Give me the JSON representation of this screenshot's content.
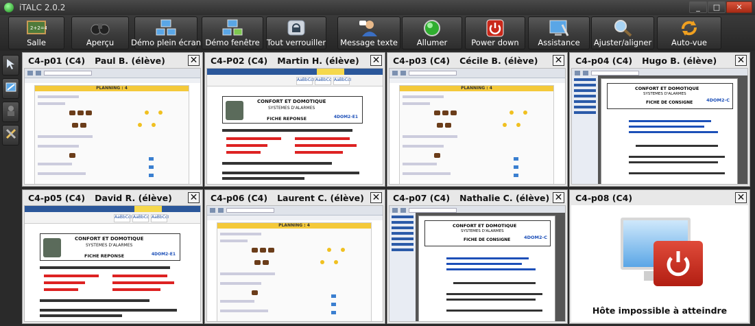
{
  "window": {
    "title": "iTALC 2.0.2",
    "buttons": [
      "_",
      "□",
      "✕"
    ]
  },
  "toolbar": {
    "buttons": [
      {
        "label": "Salle",
        "icon": "classroom-board-icon"
      },
      {
        "label": "Aperçu",
        "icon": "binoculars-icon"
      },
      {
        "label": "Démo plein écran",
        "icon": "fullscreen-demo-icon"
      },
      {
        "label": "Démo fenêtre",
        "icon": "window-demo-icon"
      },
      {
        "label": "Tout verrouiller",
        "icon": "lock-icon"
      },
      {
        "label": "Message texte",
        "icon": "message-user-icon"
      },
      {
        "label": "Allumer",
        "icon": "power-on-icon"
      },
      {
        "label": "Power down",
        "icon": "power-down-icon"
      },
      {
        "label": "Assistance",
        "icon": "remote-assistance-icon"
      },
      {
        "label": "Ajuster/aligner",
        "icon": "magnifier-icon"
      },
      {
        "label": "Auto-vue",
        "icon": "auto-view-icon"
      }
    ]
  },
  "sidebar": {
    "buttons": [
      "cursor-icon",
      "snapshot-icon",
      "user-icon",
      "tools-icon"
    ]
  },
  "tiles": [
    {
      "host": "C4-p01 (C4)",
      "user": "Paul B. (élève)",
      "screen": "planning",
      "close": "✕"
    },
    {
      "host": "C4-P02 (C4)",
      "user": "Martin H. (élève)",
      "screen": "word",
      "close": "✕"
    },
    {
      "host": "C4-p03 (C4)",
      "user": "Cécile B. (élève)",
      "screen": "planning",
      "close": "✕"
    },
    {
      "host": "C4-p04 (C4)",
      "user": "Hugo B. (élève)",
      "screen": "consigne",
      "close": "✕"
    },
    {
      "host": "C4-p05 (C4)",
      "user": "David R. (élève)",
      "screen": "word",
      "close": "✕"
    },
    {
      "host": "C4-p06 (C4)",
      "user": "Laurent C. (élève)",
      "screen": "planning",
      "close": "✕"
    },
    {
      "host": "C4-p07 (C4)",
      "user": "Nathalie C. (élève)",
      "screen": "consigne",
      "close": "✕"
    },
    {
      "host": "C4-p08 (C4)",
      "user": "",
      "screen": "unreachable",
      "close": "✕",
      "status": "Hôte impossible à atteindre"
    }
  ],
  "screens": {
    "planning": {
      "header": "PLANNING : 4"
    },
    "word": {
      "title": "CONFORT ET DOMOTIQUE",
      "subtitle": "SYSTEMES D'ALARMES",
      "doc": "FICHE REPONSE",
      "code": "4DOM2-E1",
      "styles": [
        "AaBbCcI",
        "AaBbCc",
        "AaBbCcI"
      ]
    },
    "consigne": {
      "title": "CONFORT ET DOMOTIQUE",
      "subtitle": "SYSTEMES D'ALARMES",
      "doc": "FICHE DE CONSIGNE",
      "code": "4DOM2-C"
    }
  },
  "colors": {
    "accent_red": "#b21e12",
    "link_blue": "#1c4fb8",
    "planning_yellow": "#f4c93a"
  }
}
